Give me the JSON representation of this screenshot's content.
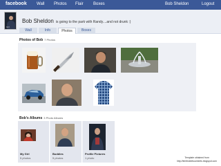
{
  "topbar": {
    "logo": "facebook",
    "nav": [
      "Wall",
      "Photos",
      "Flair",
      "Boxes"
    ],
    "user": "Bob Sheldon",
    "logout": "Logout"
  },
  "profile": {
    "name": "Bob Sheldon",
    "status": "is going to the park with Randy....and not drunk :)",
    "avatar_caption": "Girl"
  },
  "tabs": [
    "Wall",
    "Info",
    "Photos",
    "Boxes"
  ],
  "active_tab": "Photos",
  "photos_section": {
    "title": "Photos of Bob",
    "count": "7 Photos",
    "photos": [
      "beer-mug-photo",
      "knife-photo",
      "man-portrait-photo",
      "fountain-photo",
      "blue-car-photo",
      "man-smiling-photo",
      "plaid-shirt-photo"
    ]
  },
  "albums_section": {
    "title": "Bob's Albums",
    "count": "3 Photo Albums",
    "albums": [
      {
        "name": "My Girl",
        "count": "5 photos"
      },
      {
        "name": "Buddies",
        "count": "5 photos"
      },
      {
        "name": "Profile Pictures",
        "count": "1 photo"
      }
    ]
  },
  "credit": {
    "line1": "Template obtained from",
    "line2": "http://tenthsteelsocheets.blogspot.com"
  },
  "colors": {
    "brand": "#3b5998",
    "header_bg": "#eceff5",
    "panel_bg": "#eef0f5"
  }
}
